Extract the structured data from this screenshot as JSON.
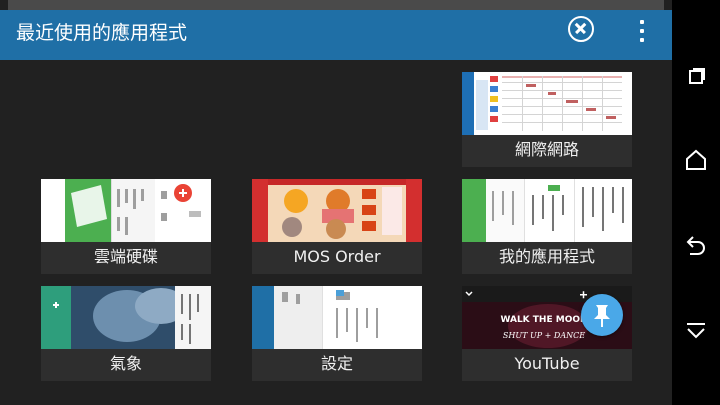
{
  "app_bar": {
    "title": "最近使用的應用程式"
  },
  "nav_bar": {
    "recents_icon": "recents-icon",
    "home_icon": "home-icon",
    "back_icon": "back-icon",
    "collapse_icon": "collapse-icon"
  },
  "cards": [
    {
      "label": "網際網路"
    },
    {
      "label": "雲端硬碟"
    },
    {
      "label": "MOS Order"
    },
    {
      "label": "我的應用程式"
    },
    {
      "label": "氣象"
    },
    {
      "label": "設定"
    },
    {
      "label": "YouTube"
    }
  ],
  "thumbs": {
    "youtube_banner_line1": "WALK THE MOON",
    "youtube_banner_line2": "SHUT UP + DANCE"
  },
  "colors": {
    "accent": "#1f6fa6",
    "pin_button": "#4aa8e8",
    "background": "#212121"
  }
}
